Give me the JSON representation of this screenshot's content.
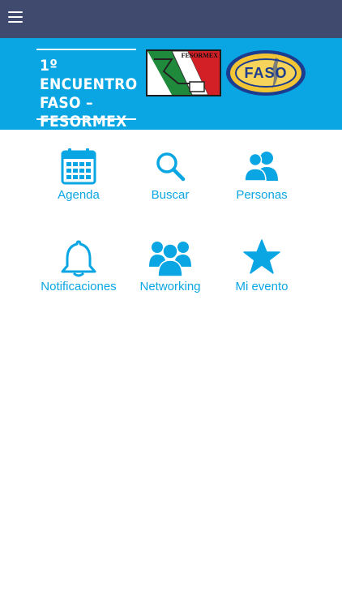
{
  "app": {
    "accent_color": "#0aa6e3",
    "topbar_color": "#3f4a6e"
  },
  "topbar": {
    "menu_icon": "hamburger-menu-icon"
  },
  "banner": {
    "title_line1": "1º ENCUENTRO",
    "title_line2": "FASO –",
    "title_line3": "FESORMEX",
    "logo_left_text": "FESORMEX",
    "logo_right_text": "FASO"
  },
  "menu": {
    "items": [
      {
        "label": "Agenda",
        "icon": "calendar-icon"
      },
      {
        "label": "Buscar",
        "icon": "search-icon"
      },
      {
        "label": "Personas",
        "icon": "people-icon"
      },
      {
        "label": "Notificaciones",
        "icon": "bell-icon"
      },
      {
        "label": "Networking",
        "icon": "group-icon"
      },
      {
        "label": "Mi evento",
        "icon": "star-icon"
      }
    ]
  }
}
